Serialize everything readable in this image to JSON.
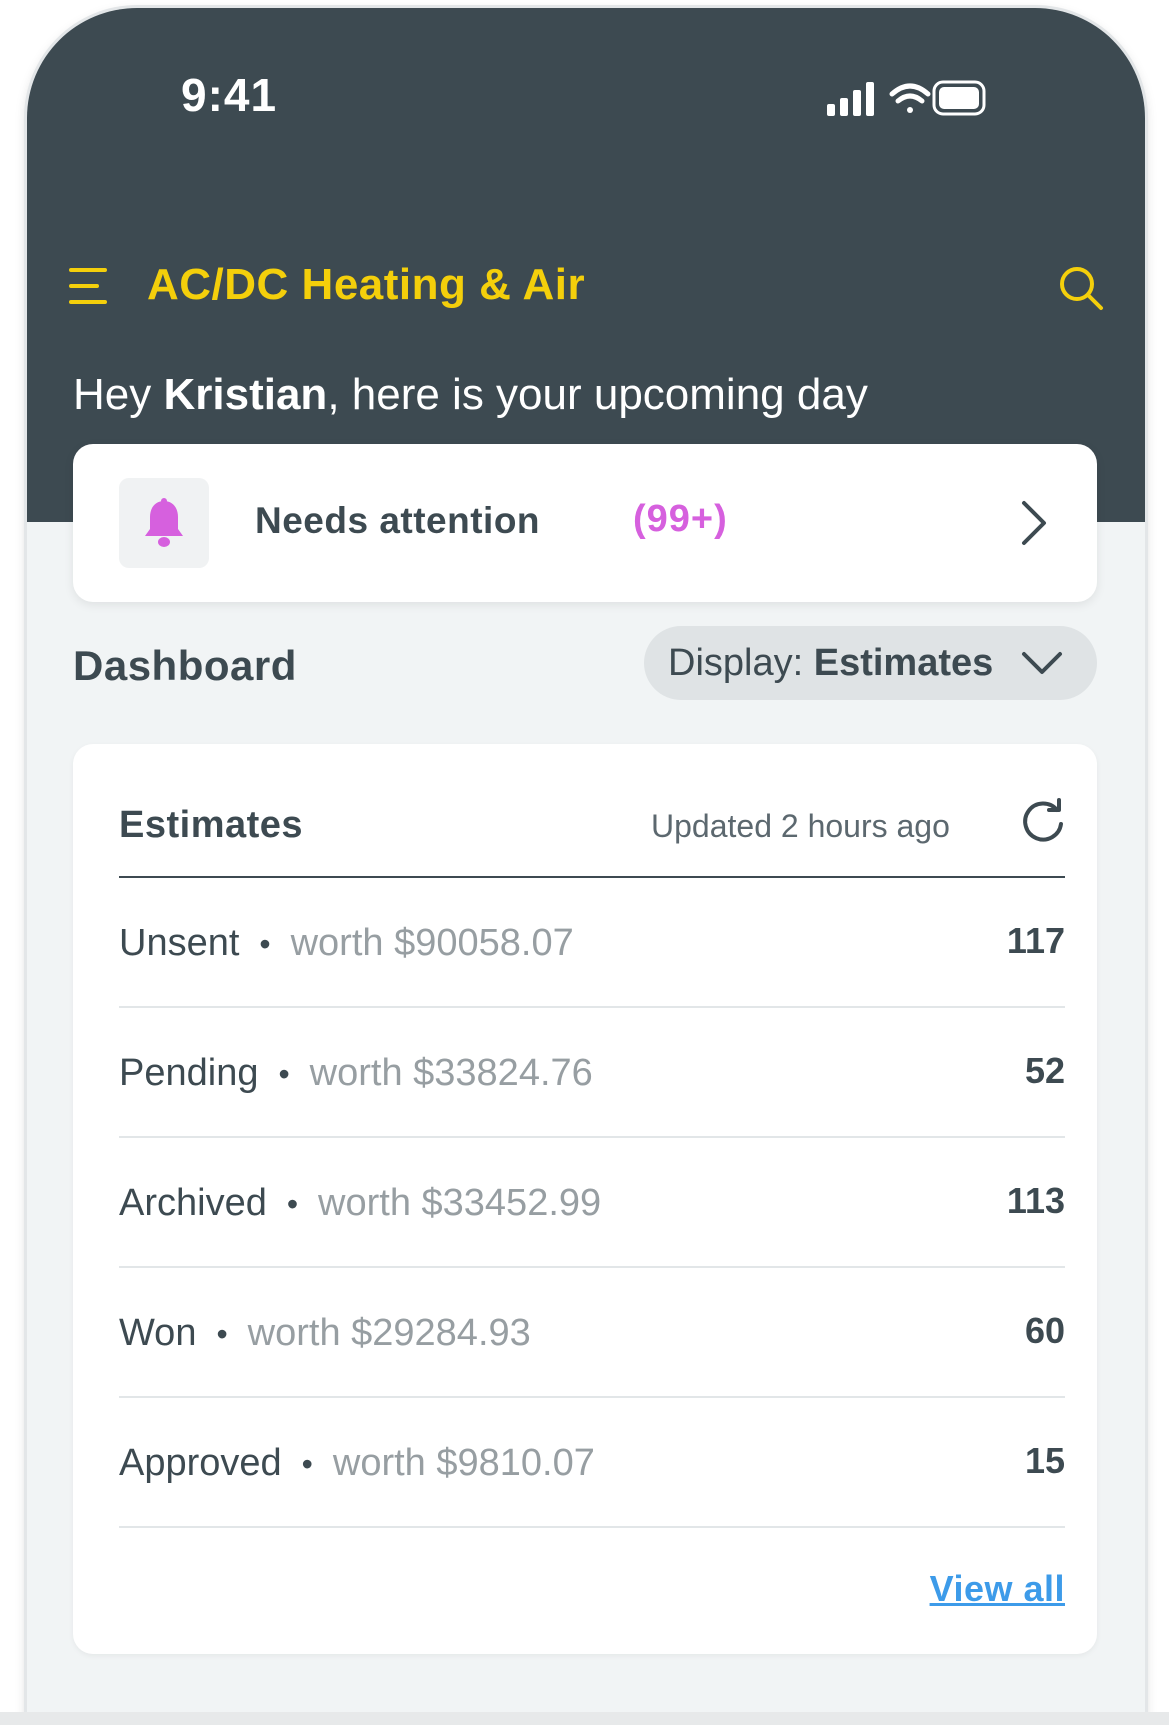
{
  "status_bar": {
    "time": "9:41"
  },
  "app_bar": {
    "title": "AC/DC Heating & Air"
  },
  "greeting": {
    "prefix": "Hey ",
    "name": "Kristian",
    "suffix": ", here is your upcoming day"
  },
  "attention": {
    "label": "Needs attention",
    "count": "(99+)",
    "accent_color": "#d660de"
  },
  "dashboard": {
    "title": "Dashboard",
    "display_prefix": "Display:",
    "display_value": "Estimates"
  },
  "estimates_card": {
    "title": "Estimates",
    "updated": "Updated 2 hours ago",
    "rows": [
      {
        "label": "Unsent",
        "worth": "worth $90058.07",
        "count": "117"
      },
      {
        "label": "Pending",
        "worth": "worth $33824.76",
        "count": "52"
      },
      {
        "label": "Archived",
        "worth": "worth $33452.99",
        "count": "113"
      },
      {
        "label": "Won",
        "worth": "worth $29284.93",
        "count": "60"
      },
      {
        "label": "Approved",
        "worth": "worth $9810.07",
        "count": "15"
      }
    ],
    "view_all": "View all"
  },
  "colors": {
    "header_bg": "#3d4a51",
    "brand_yellow": "#f4cf0b",
    "link_blue": "#3d9be9",
    "page_bg": "#f1f4f5"
  },
  "icons": [
    "menu-icon",
    "search-icon",
    "bell-icon",
    "chevron-right-icon",
    "chevron-down-icon",
    "refresh-icon",
    "signal-icon",
    "wifi-icon",
    "battery-icon"
  ]
}
